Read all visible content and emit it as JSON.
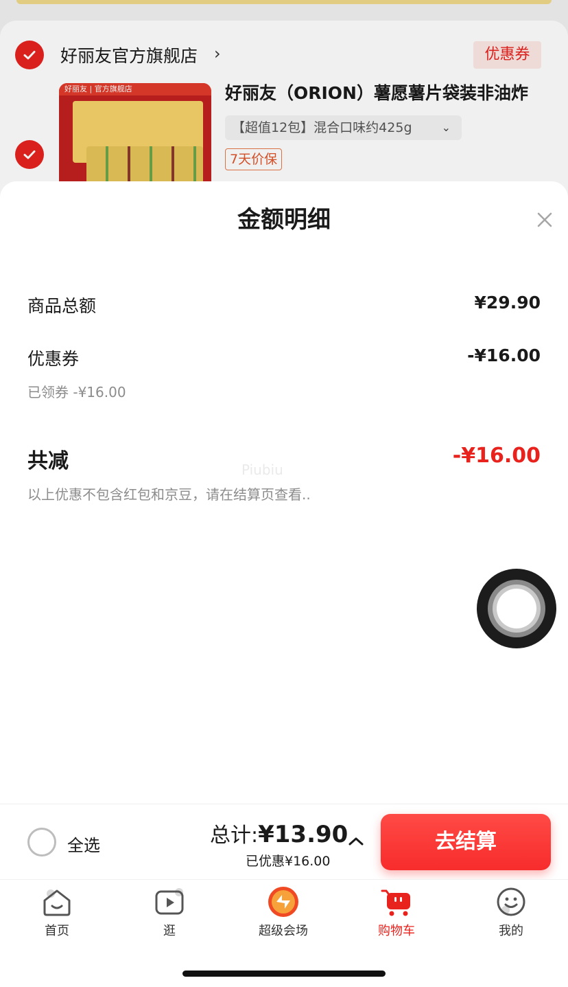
{
  "store": {
    "name": "好丽友官方旗舰店",
    "arrow": "›",
    "coupon_tag": "优惠券"
  },
  "product": {
    "image_band": "好丽友 | 官方旗舰店",
    "title": "好丽友（ORION）薯愿薯片袋装非油炸",
    "spec": "【超值12包】混合口味约425g",
    "spec_chevron": "⌄",
    "protect_tag": "7天价保"
  },
  "sheet": {
    "title": "金额明细",
    "rows": {
      "goods_total_label": "商品总额",
      "goods_total_value": "¥29.90",
      "coupon_label": "优惠券",
      "coupon_value": "-¥16.00",
      "coupon_sub": "已领券 -¥16.00"
    },
    "summary": {
      "label": "共减",
      "value": "-¥16.00",
      "note": "以上优惠不包含红包和京豆，请在结算页查看.."
    },
    "watermark": "Piubiu"
  },
  "checkout": {
    "select_all": "全选",
    "total_label": "总计:",
    "total_value": "¥13.90",
    "saved": "已优惠¥16.00",
    "pay_button": "去结算"
  },
  "tabs": [
    {
      "label": "首页",
      "icon": "home-icon"
    },
    {
      "label": "逛",
      "icon": "play-icon"
    },
    {
      "label": "超级会场",
      "icon": "super-venue-icon"
    },
    {
      "label": "购物车",
      "icon": "cart-icon"
    },
    {
      "label": "我的",
      "icon": "smiley-icon"
    }
  ],
  "colors": {
    "accent": "#e8231e",
    "muted_text": "#8c8c8c"
  }
}
